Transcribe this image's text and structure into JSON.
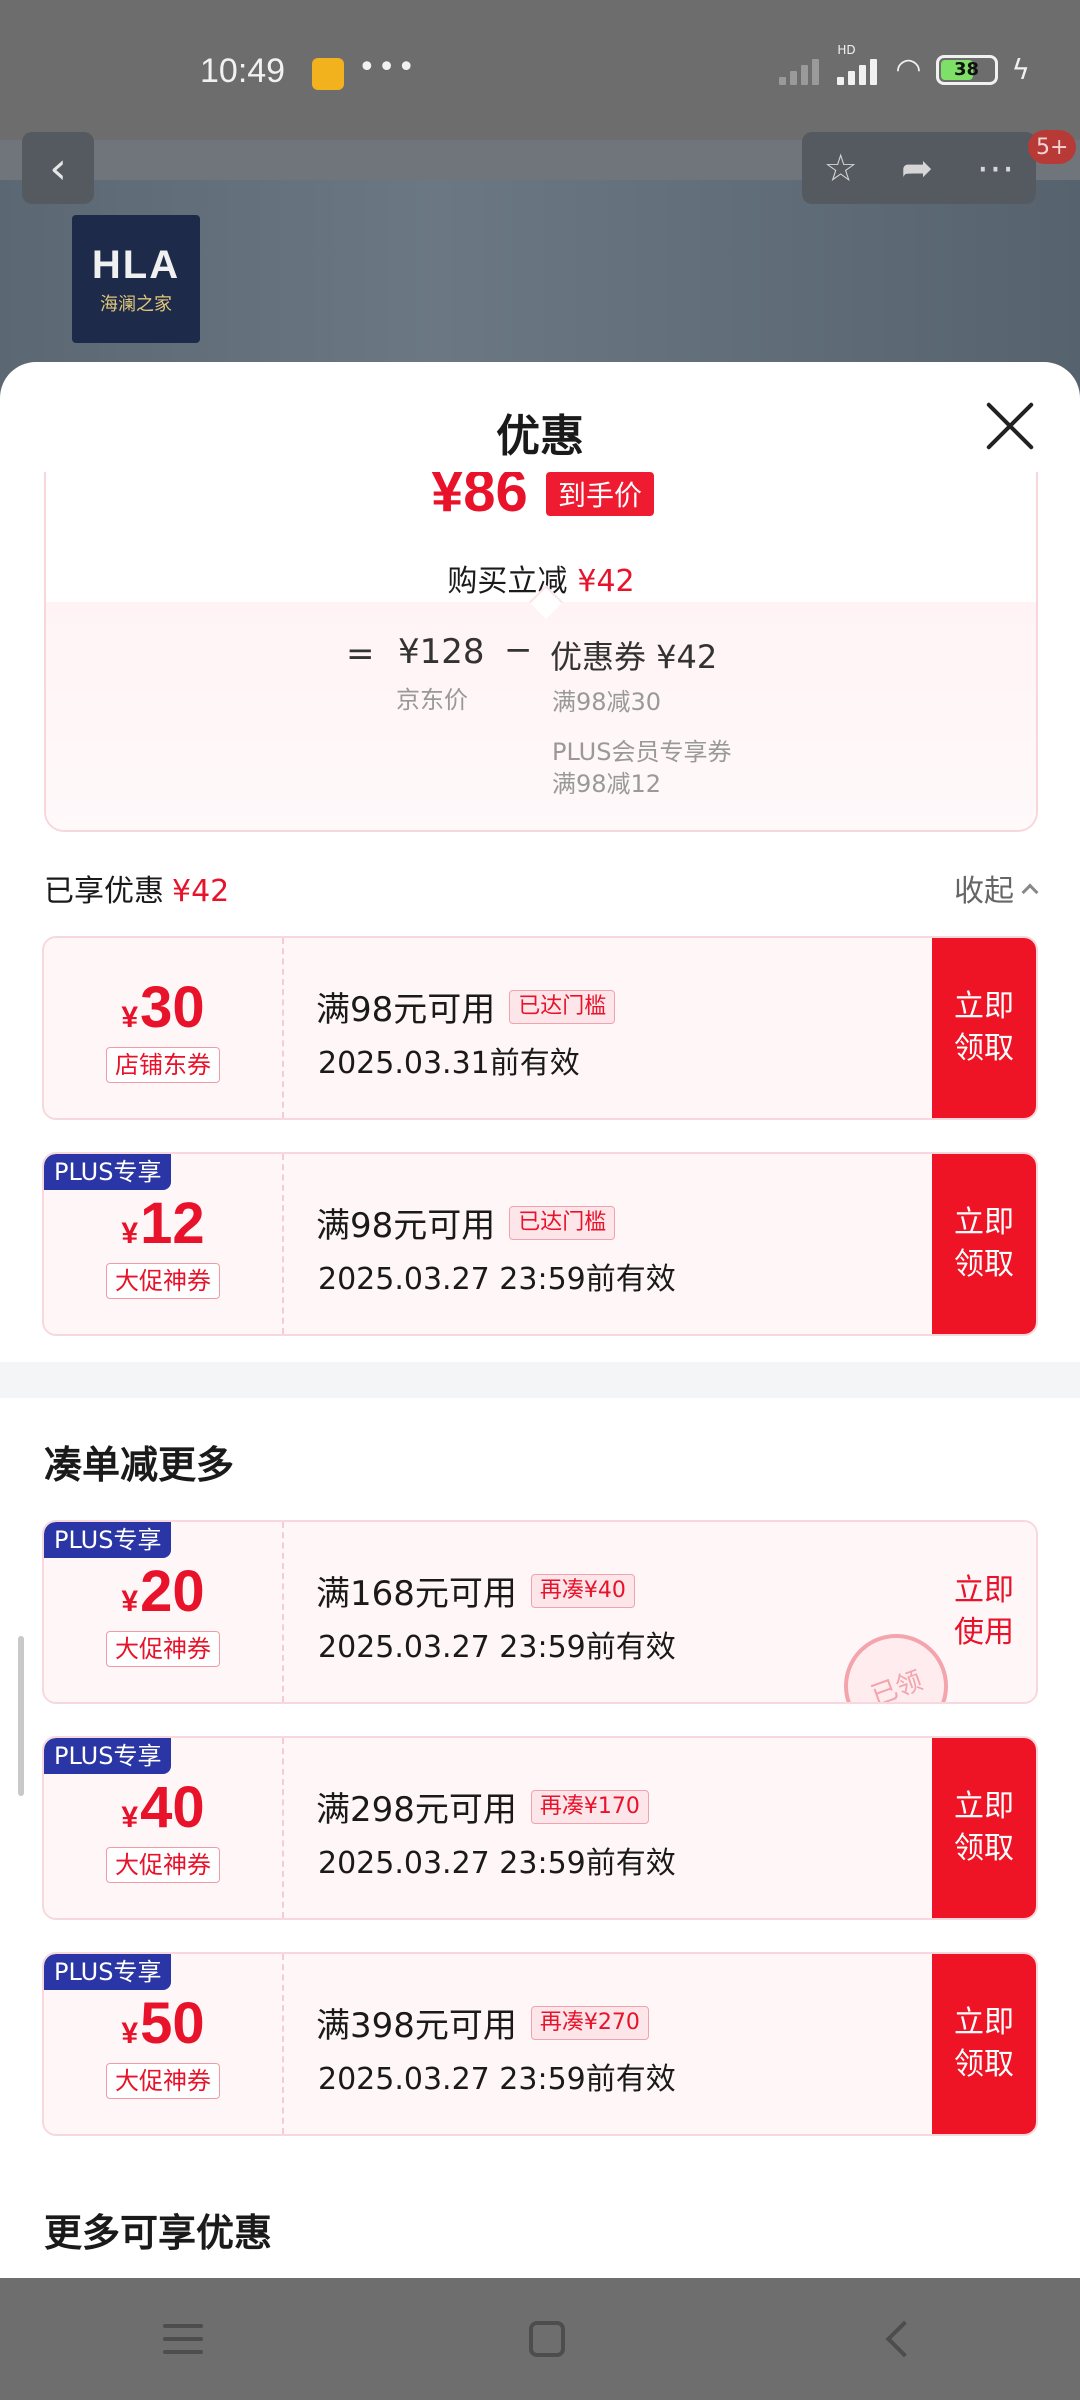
{
  "status": {
    "time": "10:49",
    "battery": "38",
    "network": "HD"
  },
  "background": {
    "brand_logo_text": "HLA",
    "brand_logo_sub": "海澜之家",
    "notification_badge": "5+"
  },
  "sheet": {
    "title": "优惠"
  },
  "price_summary": {
    "final_price": "¥86",
    "final_price_tag": "到手价",
    "instant_cut_label": "购买立减",
    "instant_cut_amount": "¥42",
    "equals": "=",
    "jd_price": "¥128",
    "jd_price_label": "京东价",
    "minus": "−",
    "coupon_total": "优惠券 ¥42",
    "coupon_line1": "满98减30",
    "coupon_line2": "PLUS会员专享券",
    "coupon_line3": "满98减12"
  },
  "enjoyed": {
    "label": "已享优惠",
    "amount": "¥42",
    "collapse_label": "收起"
  },
  "coupons_enjoyed": [
    {
      "plus_tag": "",
      "currency": "¥",
      "value": "30",
      "type": "店铺东券",
      "condition": "满98元可用",
      "badge": "已达门槛",
      "expiry": "2025.03.31前有效",
      "button": "立即领取"
    },
    {
      "plus_tag": "PLUS专享",
      "currency": "¥",
      "value": "12",
      "type": "大促神券",
      "condition": "满98元可用",
      "badge": "已达门槛",
      "expiry": "2025.03.27 23:59前有效",
      "button": "立即领取"
    }
  ],
  "section_more": {
    "title": "凑单减更多"
  },
  "coupons_more": [
    {
      "plus_tag": "PLUS专享",
      "currency": "¥",
      "value": "20",
      "type": "大促神券",
      "condition": "满168元可用",
      "badge": "再凑¥40",
      "expiry": "2025.03.27 23:59前有效",
      "button": "立即使用",
      "stamp": "已领"
    },
    {
      "plus_tag": "PLUS专享",
      "currency": "¥",
      "value": "40",
      "type": "大促神券",
      "condition": "满298元可用",
      "badge": "再凑¥170",
      "expiry": "2025.03.27 23:59前有效",
      "button": "立即领取"
    },
    {
      "plus_tag": "PLUS专享",
      "currency": "¥",
      "value": "50",
      "type": "大促神券",
      "condition": "满398元可用",
      "badge": "再凑¥270",
      "expiry": "2025.03.27 23:59前有效",
      "button": "立即领取"
    }
  ],
  "section_other": {
    "title": "更多可享优惠"
  },
  "icons": {
    "back": "back-arrow-icon",
    "star": "star-icon",
    "share": "share-icon",
    "more": "more-dots-icon",
    "close": "close-icon"
  },
  "colors": {
    "accent_red": "#e8122a",
    "button_red": "#ef1326",
    "plus_blue": "#2b36a6"
  }
}
